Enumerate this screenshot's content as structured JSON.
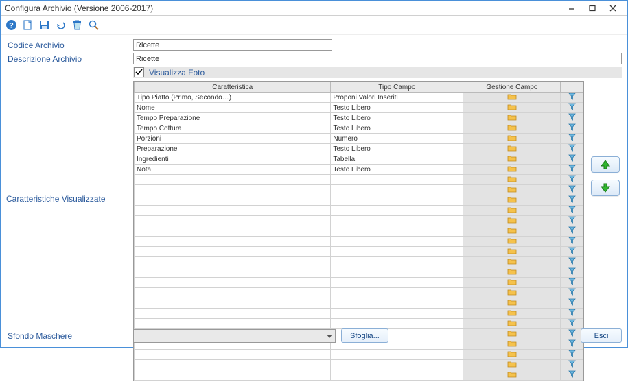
{
  "window": {
    "title": "Configura Archivio (Versione 2006-2017)"
  },
  "toolbar": {
    "help": "help-icon",
    "new": "new-document-icon",
    "save": "save-icon",
    "undo": "undo-icon",
    "delete": "trash-icon",
    "search": "magnifier-icon"
  },
  "fields": {
    "codice_label": "Codice Archivio",
    "codice_value": "Ricette",
    "descr_label": "Descrizione Archivio",
    "descr_value": "Ricette",
    "visualizza_foto_label": "Visualizza Foto",
    "visualizza_foto_checked": true
  },
  "grid": {
    "side_label": "Caratteristiche Visualizzate",
    "headers": {
      "caratteristica": "Caratteristica",
      "tipo_campo": "Tipo Campo",
      "gestione_campo": "Gestione Campo",
      "act2": ""
    },
    "rows": [
      {
        "car": "Tipo Piatto (Primo, Secondo…)",
        "tipo": "Proponi Valori Inseriti"
      },
      {
        "car": "Nome",
        "tipo": "Testo Libero"
      },
      {
        "car": "Tempo Preparazione",
        "tipo": "Testo Libero"
      },
      {
        "car": "Tempo Cottura",
        "tipo": "Testo Libero"
      },
      {
        "car": "Porzioni",
        "tipo": "Numero"
      },
      {
        "car": "Preparazione",
        "tipo": "Testo Libero"
      },
      {
        "car": "Ingredienti",
        "tipo": "Tabella"
      },
      {
        "car": "Nota",
        "tipo": "Testo Libero"
      },
      {
        "car": "",
        "tipo": ""
      },
      {
        "car": "",
        "tipo": ""
      },
      {
        "car": "",
        "tipo": ""
      },
      {
        "car": "",
        "tipo": ""
      },
      {
        "car": "",
        "tipo": ""
      },
      {
        "car": "",
        "tipo": ""
      },
      {
        "car": "",
        "tipo": ""
      },
      {
        "car": "",
        "tipo": ""
      },
      {
        "car": "",
        "tipo": ""
      },
      {
        "car": "",
        "tipo": ""
      },
      {
        "car": "",
        "tipo": ""
      },
      {
        "car": "",
        "tipo": ""
      },
      {
        "car": "",
        "tipo": ""
      },
      {
        "car": "",
        "tipo": ""
      },
      {
        "car": "",
        "tipo": ""
      },
      {
        "car": "",
        "tipo": ""
      },
      {
        "car": "",
        "tipo": ""
      },
      {
        "car": "",
        "tipo": ""
      },
      {
        "car": "",
        "tipo": ""
      },
      {
        "car": "",
        "tipo": ""
      }
    ]
  },
  "bottom": {
    "sfondo_label": "Sfondo Maschere",
    "combo_value": "",
    "sfoglia_label": "Sfoglia...",
    "esci_label": "Esci"
  }
}
